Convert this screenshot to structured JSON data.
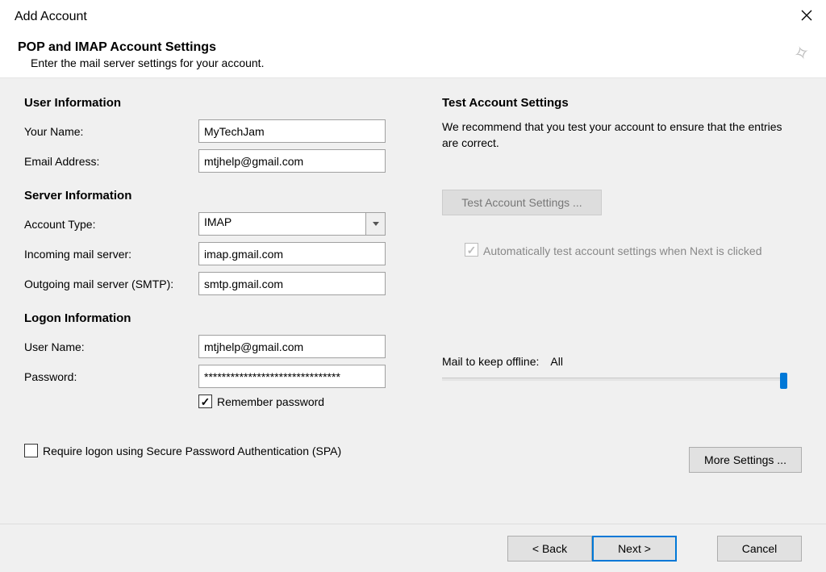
{
  "window_title": "Add Account",
  "header": {
    "heading": "POP and IMAP Account Settings",
    "subheading": "Enter the mail server settings for your account."
  },
  "left": {
    "user_info_title": "User Information",
    "your_name_label": "Your Name:",
    "your_name_value": "MyTechJam",
    "email_label": "Email Address:",
    "email_value": "mtjhelp@gmail.com",
    "server_info_title": "Server Information",
    "account_type_label": "Account Type:",
    "account_type_value": "IMAP",
    "incoming_label": "Incoming mail server:",
    "incoming_value": "imap.gmail.com",
    "outgoing_label": "Outgoing mail server (SMTP):",
    "outgoing_value": "smtp.gmail.com",
    "logon_info_title": "Logon Information",
    "username_label": "User Name:",
    "username_value": "mtjhelp@gmail.com",
    "password_label": "Password:",
    "password_value": "*******************************",
    "remember_password_label": "Remember password",
    "spa_label": "Require logon using Secure Password Authentication (SPA)"
  },
  "right": {
    "test_title": "Test Account Settings",
    "help_text": "We recommend that you test your account to ensure that the entries are correct.",
    "test_button_label": "Test Account Settings ...",
    "auto_test_label": "Automatically test account settings when Next is clicked",
    "mail_offline_label": "Mail to keep offline:",
    "mail_offline_value": "All",
    "more_settings_label": "More Settings ..."
  },
  "footer": {
    "back_label": "< Back",
    "next_label": "Next >",
    "cancel_label": "Cancel"
  }
}
